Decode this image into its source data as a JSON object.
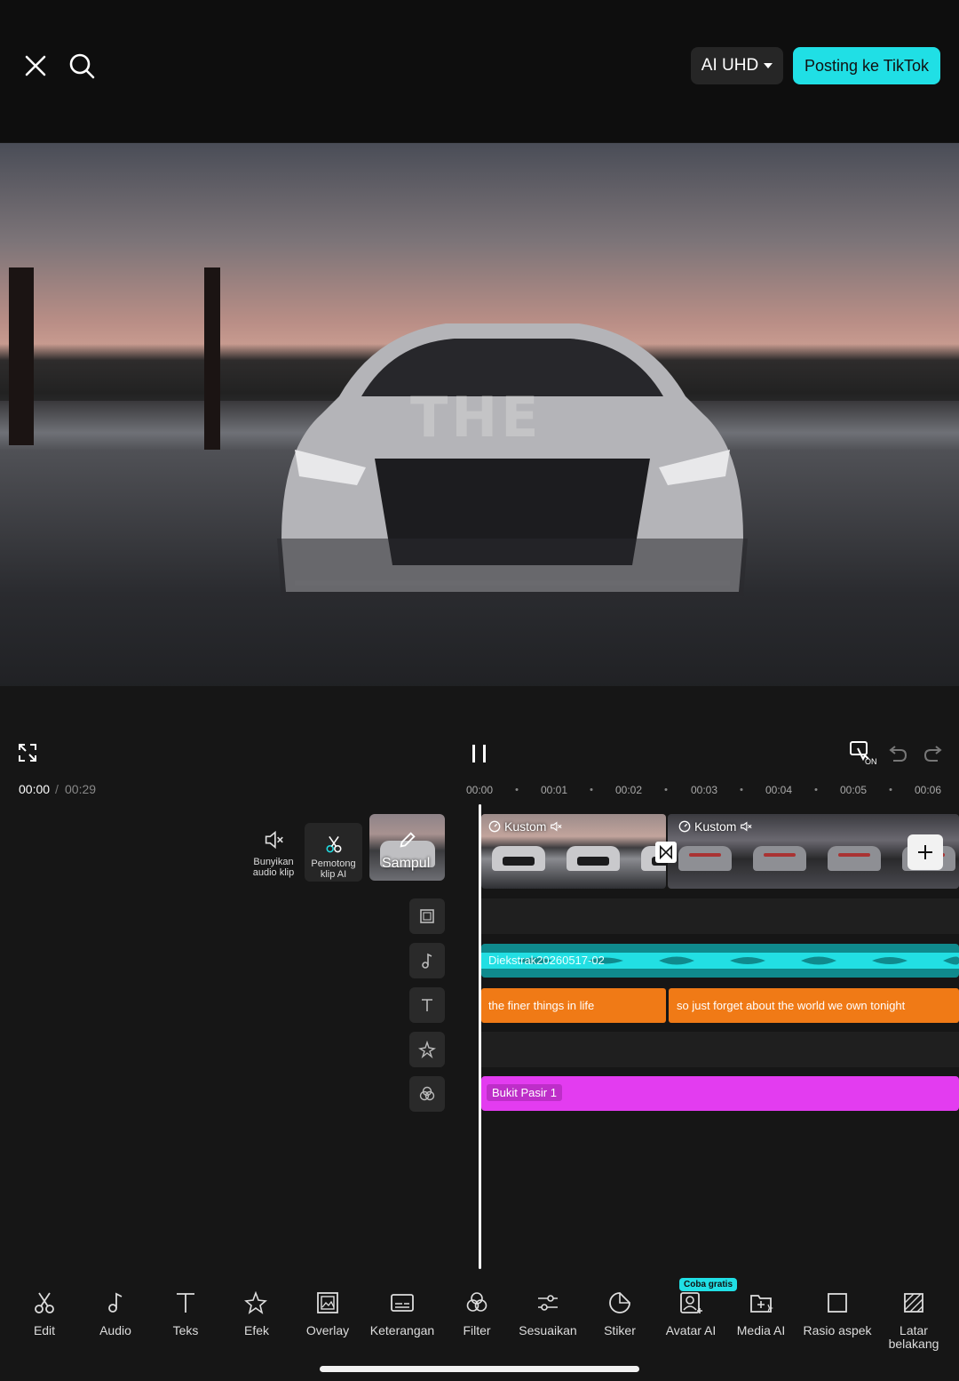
{
  "header": {
    "quality_label": "AI UHD",
    "post_label": "Posting ke TikTok"
  },
  "preview": {
    "overlay_text": "THE"
  },
  "time": {
    "current": "00:00",
    "separator": "/",
    "total": "00:29",
    "ticks": [
      "00:00",
      "00:01",
      "00:02",
      "00:03",
      "00:04",
      "00:05",
      "00:06"
    ]
  },
  "side_buttons": {
    "mute_label": "Bunyikan audio klip",
    "ai_cut_label": "Pemotong klip AI",
    "cover_label": "Sampul"
  },
  "clips": {
    "video1_tag": "Kustom",
    "video2_tag": "Kustom",
    "audio_name": "Diekstrak20260517-02",
    "text1": "the finer things in life",
    "text2": "so just forget about the world we own tonight",
    "filter_name": "Bukit Pasir 1"
  },
  "toolbar": {
    "tools": [
      "Edit",
      "Audio",
      "Teks",
      "Efek",
      "Overlay",
      "Keterangan",
      "Filter",
      "Sesuaikan",
      "Stiker",
      "Avatar AI",
      "Media AI",
      "Rasio aspek",
      "Latar belakang"
    ],
    "badge": "Coba gratis"
  },
  "colors": {
    "accent": "#20dfe5",
    "text_clip": "#f07a16",
    "filter_clip": "#e33cf0",
    "audio_clip": "#0f8a8d"
  }
}
